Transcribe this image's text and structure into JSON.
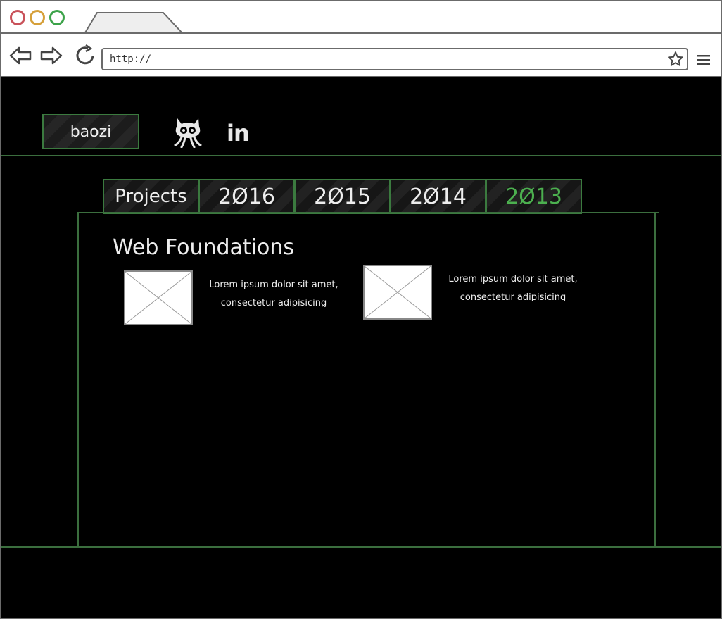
{
  "browser": {
    "url": "http://"
  },
  "header": {
    "brand": "baozi",
    "social": [
      {
        "icon": "github-icon"
      },
      {
        "icon": "linkedin-icon",
        "label": "in"
      }
    ]
  },
  "tabs": [
    {
      "label": "Projects"
    },
    {
      "label": "2Ø16"
    },
    {
      "label": "2Ø15"
    },
    {
      "label": "2Ø14"
    },
    {
      "label": "2Ø13",
      "active": true
    }
  ],
  "section": {
    "title": "Web Foundations",
    "cards": [
      {
        "text": "Lorem ipsum dolor sit amet, consectetur adipisicing"
      },
      {
        "text": "Lorem ipsum dolor sit amet, consectetur adipisicing"
      }
    ]
  },
  "colors": {
    "accent": "#4cb04f",
    "border": "#3b7a3f",
    "background": "#000000"
  }
}
